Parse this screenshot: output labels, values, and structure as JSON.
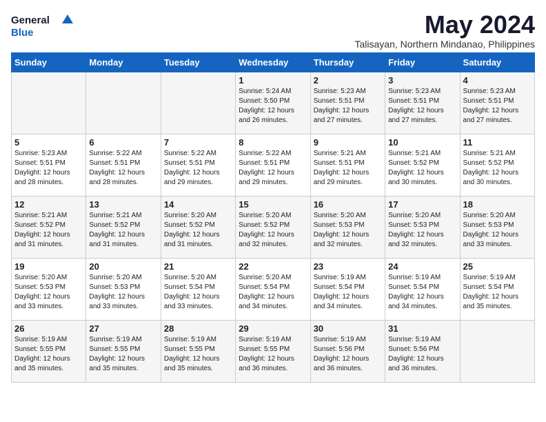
{
  "header": {
    "logo_line1": "General",
    "logo_line2": "Blue",
    "month_title": "May 2024",
    "location": "Talisayan, Northern Mindanao, Philippines"
  },
  "weekdays": [
    "Sunday",
    "Monday",
    "Tuesday",
    "Wednesday",
    "Thursday",
    "Friday",
    "Saturday"
  ],
  "weeks": [
    [
      {
        "day": "",
        "sunrise": "",
        "sunset": "",
        "daylight": ""
      },
      {
        "day": "",
        "sunrise": "",
        "sunset": "",
        "daylight": ""
      },
      {
        "day": "",
        "sunrise": "",
        "sunset": "",
        "daylight": ""
      },
      {
        "day": "1",
        "sunrise": "Sunrise: 5:24 AM",
        "sunset": "Sunset: 5:50 PM",
        "daylight": "Daylight: 12 hours and 26 minutes."
      },
      {
        "day": "2",
        "sunrise": "Sunrise: 5:23 AM",
        "sunset": "Sunset: 5:51 PM",
        "daylight": "Daylight: 12 hours and 27 minutes."
      },
      {
        "day": "3",
        "sunrise": "Sunrise: 5:23 AM",
        "sunset": "Sunset: 5:51 PM",
        "daylight": "Daylight: 12 hours and 27 minutes."
      },
      {
        "day": "4",
        "sunrise": "Sunrise: 5:23 AM",
        "sunset": "Sunset: 5:51 PM",
        "daylight": "Daylight: 12 hours and 27 minutes."
      }
    ],
    [
      {
        "day": "5",
        "sunrise": "Sunrise: 5:23 AM",
        "sunset": "Sunset: 5:51 PM",
        "daylight": "Daylight: 12 hours and 28 minutes."
      },
      {
        "day": "6",
        "sunrise": "Sunrise: 5:22 AM",
        "sunset": "Sunset: 5:51 PM",
        "daylight": "Daylight: 12 hours and 28 minutes."
      },
      {
        "day": "7",
        "sunrise": "Sunrise: 5:22 AM",
        "sunset": "Sunset: 5:51 PM",
        "daylight": "Daylight: 12 hours and 29 minutes."
      },
      {
        "day": "8",
        "sunrise": "Sunrise: 5:22 AM",
        "sunset": "Sunset: 5:51 PM",
        "daylight": "Daylight: 12 hours and 29 minutes."
      },
      {
        "day": "9",
        "sunrise": "Sunrise: 5:21 AM",
        "sunset": "Sunset: 5:51 PM",
        "daylight": "Daylight: 12 hours and 29 minutes."
      },
      {
        "day": "10",
        "sunrise": "Sunrise: 5:21 AM",
        "sunset": "Sunset: 5:52 PM",
        "daylight": "Daylight: 12 hours and 30 minutes."
      },
      {
        "day": "11",
        "sunrise": "Sunrise: 5:21 AM",
        "sunset": "Sunset: 5:52 PM",
        "daylight": "Daylight: 12 hours and 30 minutes."
      }
    ],
    [
      {
        "day": "12",
        "sunrise": "Sunrise: 5:21 AM",
        "sunset": "Sunset: 5:52 PM",
        "daylight": "Daylight: 12 hours and 31 minutes."
      },
      {
        "day": "13",
        "sunrise": "Sunrise: 5:21 AM",
        "sunset": "Sunset: 5:52 PM",
        "daylight": "Daylight: 12 hours and 31 minutes."
      },
      {
        "day": "14",
        "sunrise": "Sunrise: 5:20 AM",
        "sunset": "Sunset: 5:52 PM",
        "daylight": "Daylight: 12 hours and 31 minutes."
      },
      {
        "day": "15",
        "sunrise": "Sunrise: 5:20 AM",
        "sunset": "Sunset: 5:52 PM",
        "daylight": "Daylight: 12 hours and 32 minutes."
      },
      {
        "day": "16",
        "sunrise": "Sunrise: 5:20 AM",
        "sunset": "Sunset: 5:53 PM",
        "daylight": "Daylight: 12 hours and 32 minutes."
      },
      {
        "day": "17",
        "sunrise": "Sunrise: 5:20 AM",
        "sunset": "Sunset: 5:53 PM",
        "daylight": "Daylight: 12 hours and 32 minutes."
      },
      {
        "day": "18",
        "sunrise": "Sunrise: 5:20 AM",
        "sunset": "Sunset: 5:53 PM",
        "daylight": "Daylight: 12 hours and 33 minutes."
      }
    ],
    [
      {
        "day": "19",
        "sunrise": "Sunrise: 5:20 AM",
        "sunset": "Sunset: 5:53 PM",
        "daylight": "Daylight: 12 hours and 33 minutes."
      },
      {
        "day": "20",
        "sunrise": "Sunrise: 5:20 AM",
        "sunset": "Sunset: 5:53 PM",
        "daylight": "Daylight: 12 hours and 33 minutes."
      },
      {
        "day": "21",
        "sunrise": "Sunrise: 5:20 AM",
        "sunset": "Sunset: 5:54 PM",
        "daylight": "Daylight: 12 hours and 33 minutes."
      },
      {
        "day": "22",
        "sunrise": "Sunrise: 5:20 AM",
        "sunset": "Sunset: 5:54 PM",
        "daylight": "Daylight: 12 hours and 34 minutes."
      },
      {
        "day": "23",
        "sunrise": "Sunrise: 5:19 AM",
        "sunset": "Sunset: 5:54 PM",
        "daylight": "Daylight: 12 hours and 34 minutes."
      },
      {
        "day": "24",
        "sunrise": "Sunrise: 5:19 AM",
        "sunset": "Sunset: 5:54 PM",
        "daylight": "Daylight: 12 hours and 34 minutes."
      },
      {
        "day": "25",
        "sunrise": "Sunrise: 5:19 AM",
        "sunset": "Sunset: 5:54 PM",
        "daylight": "Daylight: 12 hours and 35 minutes."
      }
    ],
    [
      {
        "day": "26",
        "sunrise": "Sunrise: 5:19 AM",
        "sunset": "Sunset: 5:55 PM",
        "daylight": "Daylight: 12 hours and 35 minutes."
      },
      {
        "day": "27",
        "sunrise": "Sunrise: 5:19 AM",
        "sunset": "Sunset: 5:55 PM",
        "daylight": "Daylight: 12 hours and 35 minutes."
      },
      {
        "day": "28",
        "sunrise": "Sunrise: 5:19 AM",
        "sunset": "Sunset: 5:55 PM",
        "daylight": "Daylight: 12 hours and 35 minutes."
      },
      {
        "day": "29",
        "sunrise": "Sunrise: 5:19 AM",
        "sunset": "Sunset: 5:55 PM",
        "daylight": "Daylight: 12 hours and 36 minutes."
      },
      {
        "day": "30",
        "sunrise": "Sunrise: 5:19 AM",
        "sunset": "Sunset: 5:56 PM",
        "daylight": "Daylight: 12 hours and 36 minutes."
      },
      {
        "day": "31",
        "sunrise": "Sunrise: 5:19 AM",
        "sunset": "Sunset: 5:56 PM",
        "daylight": "Daylight: 12 hours and 36 minutes."
      },
      {
        "day": "",
        "sunrise": "",
        "sunset": "",
        "daylight": ""
      }
    ]
  ]
}
